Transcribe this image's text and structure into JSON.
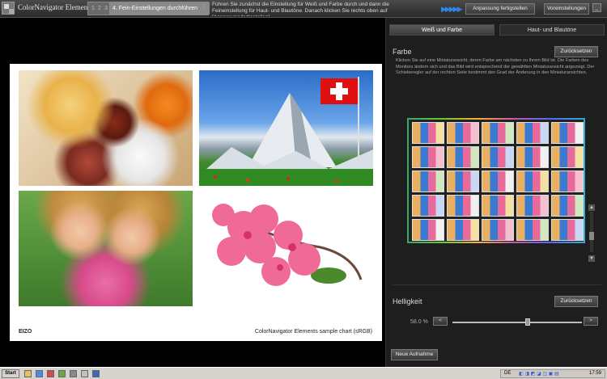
{
  "app": {
    "title": "ColorNavigator Elements"
  },
  "steps": {
    "step1": "1",
    "step2": "2",
    "step3": "3",
    "active_label": "4. Fein-Einstellungen durchführen",
    "step5": "5"
  },
  "header": {
    "instruction": "Führen Sie zunächst die Einstellung für Weiß und Farbe durch und dann die Feineinstellung für Haut- und Blautöne. Danach klicken Sie rechts oben auf [Anpassung fertigstellen].",
    "arrows": "▶▶▶▶▶",
    "finish_button": "Anpassung fertigstellen",
    "preferences_button": "Voreinstellungen",
    "minimize": "_",
    "close": "×"
  },
  "canvas": {
    "caption": "ColorNavigator Elements sample chart (sRGB)",
    "logo": "EIZO",
    "photos": [
      "breakfast-photo",
      "matterhorn-photo",
      "girls-photo",
      "blossom-photo"
    ]
  },
  "panel": {
    "tabs": [
      {
        "label": "Weiß und Farbe",
        "active": true
      },
      {
        "label": "Haut- und Blautöne",
        "active": false
      }
    ],
    "color_section": {
      "title": "Farbe",
      "reset_button": "Zurücksetzen",
      "description": "Klicken Sie auf eine Miniaturansicht, deren Farbe am nächsten zu Ihrem Bild ist. Die Farben des Monitors ändern sich und das Bild wird entsprechend der gewählten Miniaturansicht angezeigt. Der Schieberegler auf der rechten Seite bestimmt den Grad der Änderung in den Miniaturansichten.",
      "thumbnail_rows": 5,
      "thumbnail_cols": 5
    },
    "brightness_section": {
      "title": "Helligkeit",
      "reset_button": "Zurücksetzen",
      "value_text": "58.0 %",
      "value": 58.0,
      "decrease": "<",
      "increase": ">"
    },
    "new_adjustment_button": "Neue Aufnahme"
  },
  "taskbar": {
    "start": "Start",
    "language": "DE",
    "clock": "17:59"
  },
  "colors": {
    "accent": "#2f86e8",
    "panel_bg": "#1e1e1e"
  }
}
